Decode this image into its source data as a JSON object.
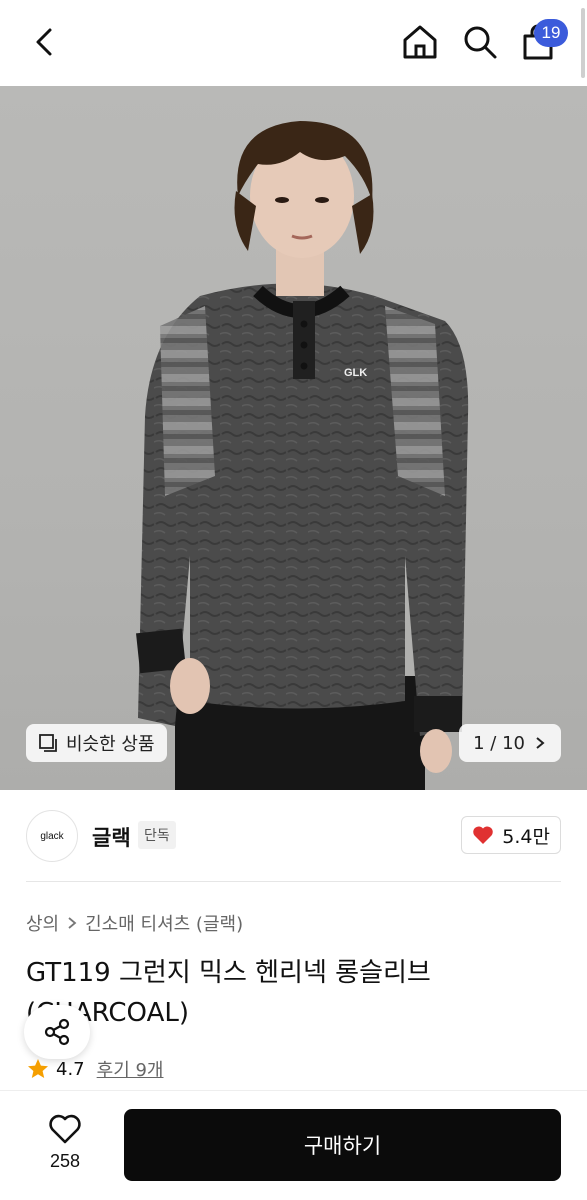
{
  "header": {
    "cart_count": "19",
    "icons": [
      "back-icon",
      "home-icon",
      "search-icon",
      "shopping-bag-icon"
    ]
  },
  "gallery": {
    "similar_label": "비슷한 상품",
    "page_indicator": "1 / 10",
    "logo_print": "GLK"
  },
  "seller": {
    "logo_text": "glack",
    "name": "글랙",
    "exclusive_tag": "단독",
    "likes": "5.4만"
  },
  "product": {
    "category": "상의",
    "subcategory": "긴소매 티셔츠 (글랙)",
    "title": "GT119 그런지 믹스 헨리넥 롱슬리브 (CHARCOAL)",
    "rating": "4.7",
    "reviews": "후기 9개"
  },
  "bottom": {
    "wish_count": "258",
    "buy_label": "구매하기"
  },
  "colors": {
    "accent_badge": "#3b5bdb",
    "heart": "#e03131",
    "star": "#f59f00",
    "buy_button": "#0b0b0b"
  }
}
